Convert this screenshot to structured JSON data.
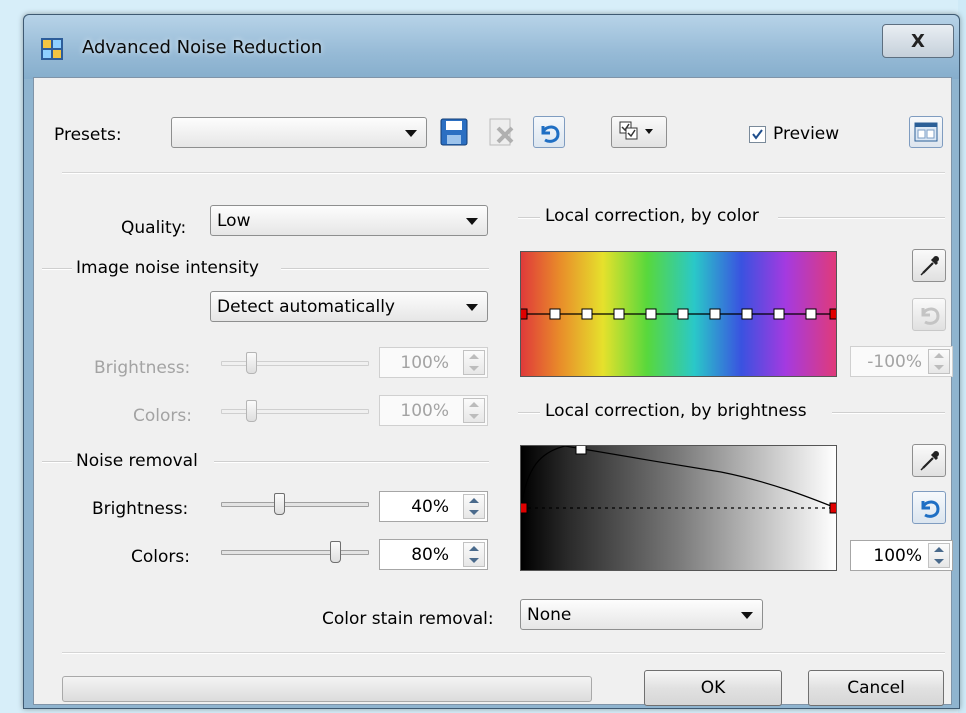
{
  "window": {
    "title": "Advanced Noise Reduction",
    "close_glyph": "X"
  },
  "toolbar": {
    "presets_label": "Presets:",
    "presets_value": "",
    "save_icon": "save-preset-icon",
    "delete_icon": "delete-preset-icon",
    "reset_icon": "reset-icon",
    "options_icon": "options-menu-icon",
    "preview_label": "Preview",
    "preview_checked": true,
    "layout_icon": "layout-toggle-icon"
  },
  "quality": {
    "label": "Quality:",
    "value": "Low"
  },
  "image_noise": {
    "group_label": "Image noise intensity",
    "mode": "Detect automatically",
    "brightness_label": "Brightness:",
    "brightness_value": "100%",
    "colors_label": "Colors:",
    "colors_value": "100%"
  },
  "noise_removal": {
    "group_label": "Noise removal",
    "brightness_label": "Brightness:",
    "brightness_value": "40%",
    "brightness_level": 0.4,
    "colors_label": "Colors:",
    "colors_value": "80%",
    "colors_level": 0.8
  },
  "color_stain": {
    "label": "Color stain removal:",
    "value": "None"
  },
  "local_color": {
    "group_label": "Local correction, by color",
    "value": "-100%"
  },
  "local_brightness": {
    "group_label": "Local correction, by brightness",
    "value": "100%"
  },
  "footer": {
    "ok_label": "OK",
    "cancel_label": "Cancel"
  },
  "colors": {
    "accent_red": "#e00000",
    "icon_blue": "#1f6fc4",
    "window_frame": "#8fb4cf"
  }
}
